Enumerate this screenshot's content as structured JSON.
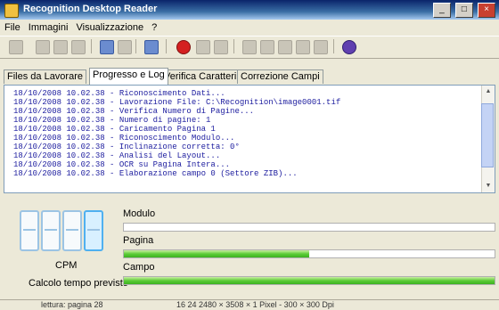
{
  "window": {
    "title": "Recognition Desktop Reader",
    "buttons": {
      "minimize": "_",
      "maximize": "□",
      "close": "×"
    }
  },
  "menu": [
    "File",
    "Immagini",
    "Visualizzazione",
    "?"
  ],
  "toolbar": {
    "icons": [
      "new-icon",
      "open-icon",
      "save-icon",
      "print-icon",
      "cut-icon",
      "copy-icon",
      "stop-icon",
      "page-prev-icon",
      "page-next-icon",
      "zoom-icon",
      "fit-icon",
      "rotate-icon",
      "grid-icon",
      "settings-icon",
      "info-icon"
    ]
  },
  "tabs": [
    {
      "label": "Files da Lavorare",
      "active": false
    },
    {
      "label": "Progresso e Log",
      "active": true
    },
    {
      "label": "Verifica Caratteri",
      "active": false
    },
    {
      "label": "Correzione Campi",
      "active": false
    }
  ],
  "log": [
    "18/10/2008 10.02.38 - Riconoscimento Dati...",
    "18/10/2008 10.02.38 - Lavorazione File: C:\\Recognition\\image0001.tif",
    "18/10/2008 10.02.38 - Verifica Numero di Pagine...",
    "18/10/2008 10.02.38 - Numero di pagine: 1",
    "18/10/2008 10.02.38 - Caricamento Pagina 1",
    "18/10/2008 10.02.38 - Riconoscimento Modulo...",
    "18/10/2008 10.02.38 - Inclinazione corretta: 0°",
    "18/10/2008 10.02.38 - Analisi del Layout...",
    "18/10/2008 10.02.38 - OCR su Pagina Intera...",
    "18/10/2008 10.02.38 - Elaborazione campo 0 (Settore ZIB)..."
  ],
  "progress": {
    "counter_label": "CPM",
    "calc_label": "Calcolo tempo previsto",
    "bars": [
      {
        "label": "Modulo",
        "fraction": 0.0
      },
      {
        "label": "Pagina",
        "fraction": 0.5
      },
      {
        "label": "Campo",
        "fraction": 1.0
      }
    ]
  },
  "status": {
    "left": "lettura: pagina 28",
    "right": "16 24 2480 × 3508 × 1 Pixel - 300 × 300 Dpi"
  },
  "colors": {
    "log_text": "#2020a0",
    "progress_fill": "#5ccc38",
    "title_bar": "#0a246a"
  }
}
